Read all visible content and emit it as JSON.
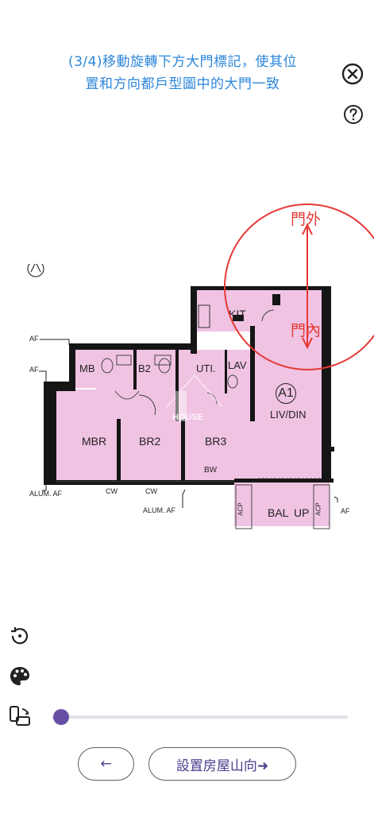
{
  "instruction": {
    "line1": "(3/4)移動旋轉下方大門標記，使其位",
    "line2": "置和方向都戶型圖中的大門一致"
  },
  "floorplan": {
    "rooms": {
      "kit": "KIT",
      "mb": "MB",
      "b2": "B2",
      "uti": "UTI.",
      "lav": "LAV",
      "unit": "A1",
      "livdin": "LIV/DIN",
      "mbr": "MBR",
      "br2": "BR2",
      "br3": "BR3",
      "bw": "BW",
      "bal": "BAL",
      "up": "UP",
      "acp": "ACP"
    },
    "annotations": {
      "af1": "AF",
      "af2": "AF",
      "af3": "AF",
      "alum_af1": "ALUM. AF",
      "alum_af2": "ALUM. AF",
      "cw1": "CW",
      "cw2": "CW"
    },
    "watermark": "HOUSE"
  },
  "door_marker": {
    "outside_label": "門外",
    "inside_label": "門內",
    "color": "#e53935"
  },
  "tools": {
    "reset_icon": "rotate-reset-icon",
    "palette_icon": "palette-icon",
    "rotate_icon": "screen-rotation-icon"
  },
  "slider": {
    "value_fraction": 0.03,
    "accent": "#6750a4"
  },
  "buttons": {
    "back_label": "←",
    "next_label": "設置房屋山向➜"
  }
}
